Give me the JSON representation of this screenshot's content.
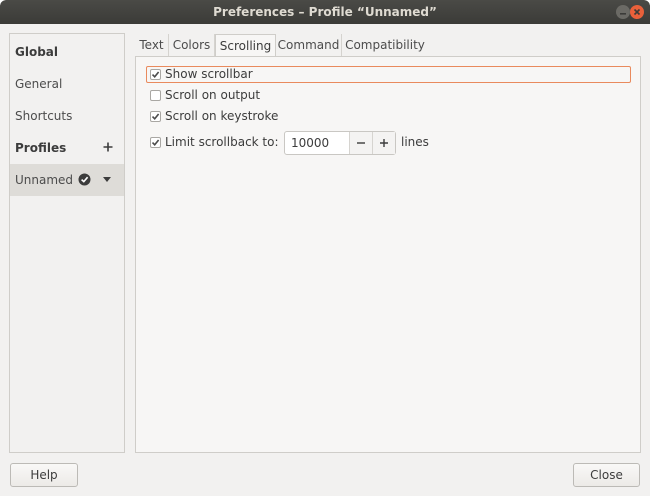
{
  "window": {
    "title": "Preferences – Profile “Unnamed”",
    "minimize_icon": "minimize-icon",
    "close_icon": "close-icon",
    "close_color": "#e9603a"
  },
  "sidebar": {
    "global_label": "Global",
    "general_label": "General",
    "shortcuts_label": "Shortcuts",
    "profiles_label": "Profiles",
    "add_profile_icon": "plus-icon",
    "profile_name": "Unnamed",
    "profile_default_icon": "check-circle-icon",
    "profile_menu_icon": "chevron-down-icon"
  },
  "tabs": [
    {
      "label": "Text"
    },
    {
      "label": "Colors"
    },
    {
      "label": "Scrolling",
      "active": true
    },
    {
      "label": "Command"
    },
    {
      "label": "Compatibility"
    }
  ],
  "scrolling": {
    "show_scrollbar": {
      "label": "Show scrollbar",
      "checked": true
    },
    "scroll_on_output": {
      "label": "Scroll on output",
      "checked": false
    },
    "scroll_on_keystroke": {
      "label": "Scroll on keystroke",
      "checked": true
    },
    "limit_scrollback": {
      "label": "Limit scrollback to:",
      "checked": true
    },
    "scrollback_value": "10000",
    "lines_label": "lines",
    "focus_color": "#e98a5d"
  },
  "footer": {
    "help_label": "Help",
    "close_label": "Close"
  }
}
